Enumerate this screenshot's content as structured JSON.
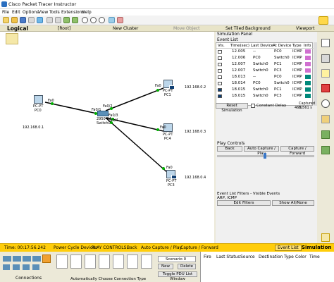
{
  "window": {
    "title": "Cisco Packet Tracer Instructor"
  },
  "menu": [
    "File",
    "Edit",
    "Options",
    "View",
    "Tools",
    "Extensions",
    "Help"
  ],
  "modebar": {
    "logical": "Logical",
    "root": "[Root]",
    "new_cluster": "New Cluster",
    "move_object": "Move Object",
    "set_tiled": "Set Tiled Background",
    "viewport": "Viewport"
  },
  "topology": {
    "devices": [
      {
        "name": "PC0",
        "type": "PC-PT",
        "ip": "192.168.0.1"
      },
      {
        "name": "Switch0",
        "type": "2950-24"
      },
      {
        "name": "PC1",
        "type": "PC-PT",
        "ip": "192.168.0.2"
      },
      {
        "name": "PC4",
        "type": "PC-PT",
        "ip": "192.168.0.3"
      },
      {
        "name": "PC3",
        "type": "PC-PT",
        "ip": "192.168.0.4"
      }
    ],
    "ports": {
      "pc0": "Fa0",
      "sw_a": "Fa0/1",
      "sw_b": "Fa0/2",
      "sw_c": "Fa0/3",
      "sw_d": "Fa0/4",
      "pc1": "Fa0",
      "pc4": "Fa0",
      "pc3": "Fa0"
    }
  },
  "sim": {
    "title": "Simulation Panel",
    "event_list": "Event List",
    "columns": [
      "Vis.",
      "Time(sec)",
      "Last Device",
      "At Device",
      "Type",
      "Info"
    ],
    "events": [
      {
        "time": "12.005",
        "last": "--",
        "at": "PC0",
        "type": "ICMP",
        "color": "#d070d0"
      },
      {
        "time": "12.006",
        "last": "PC0",
        "at": "Switch0",
        "type": "ICMP",
        "color": "#d070d0"
      },
      {
        "time": "12.007",
        "last": "Switch0",
        "at": "PC1",
        "type": "ICMP",
        "color": "#d070d0"
      },
      {
        "time": "12.007",
        "last": "Switch0",
        "at": "PC3",
        "type": "ICMP",
        "color": "#d070d0"
      },
      {
        "time": "18.013",
        "last": "--",
        "at": "PC0",
        "type": "ICMP",
        "color": "#00897b"
      },
      {
        "time": "18.014",
        "last": "PC0",
        "at": "Switch0",
        "type": "ICMP",
        "color": "#00897b"
      },
      {
        "time": "18.015",
        "last": "Switch0",
        "at": "PC1",
        "type": "ICMP",
        "color": "#00897b"
      },
      {
        "time": "18.015",
        "last": "Switch0",
        "at": "PC3",
        "type": "ICMP",
        "color": "#00897b"
      }
    ],
    "reset": "Reset Simulation",
    "constant_delay": "Constant Delay",
    "captured_to": "Captured to:",
    "captured_value": "468.561 s",
    "play_controls": "Play Controls",
    "back": "Back",
    "auto_capture": "Auto Capture / Play",
    "capture_forward": "Capture / Forward",
    "filters_title": "Event List Filters - Visible Events",
    "filters_value": "ARP, ICMP",
    "edit_filters": "Edit Filters",
    "show_all": "Show All/None"
  },
  "status": {
    "time": "Time: 00:17:56.242",
    "power": "Power Cycle Devices",
    "play": "PLAY CONTROLS:",
    "back": "Back",
    "auto": "Auto Capture / Play",
    "forward": "Capture / Forward",
    "event_list": "Event List",
    "simulation": "Simulation"
  },
  "bottom": {
    "connections": "Connections",
    "auto_conn": "Automatically Choose Connection Type",
    "scenario": "Scenario 0",
    "new": "New",
    "delete": "Delete",
    "toggle_pdu": "Toggle PDU List Window",
    "pdu_cols": [
      "Fire",
      "Last Status",
      "Source",
      "Destination",
      "Type",
      "Color",
      "Time"
    ]
  }
}
